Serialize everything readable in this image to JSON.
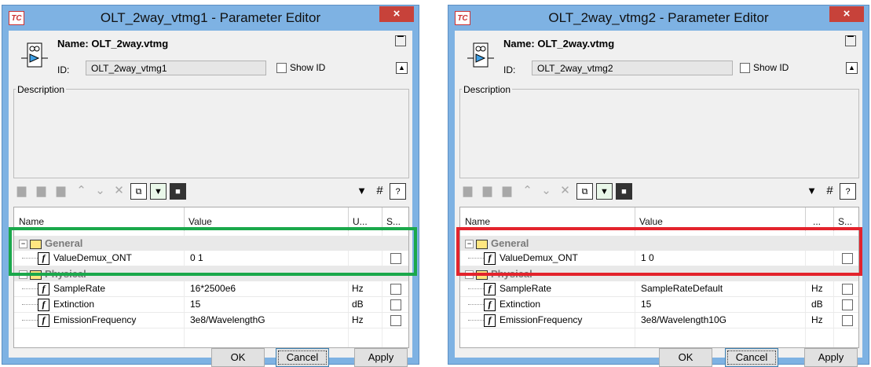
{
  "background_text": "►",
  "windows": [
    {
      "app_icon": "TC",
      "title": "OLT_2way_vtmg1 - Parameter Editor",
      "close": "×",
      "name_label": "Name:",
      "name_value": "OLT_2way.vtmg",
      "id_label": "ID:",
      "id_value": "OLT_2way_vtmg1",
      "show_id": "Show ID",
      "description_label": "Description",
      "columns": {
        "name": "Name",
        "value": "Value",
        "unit": "U...",
        "s": "S..."
      },
      "groups": [
        {
          "label": "General",
          "params": [
            {
              "name": "ValueDemux_ONT",
              "value": "0 1",
              "unit": ""
            }
          ]
        },
        {
          "label": "Physical",
          "params": [
            {
              "name": "SampleRate",
              "value": "16*2500e6",
              "unit": "Hz"
            },
            {
              "name": "Extinction",
              "value": "15",
              "unit": "dB"
            },
            {
              "name": "EmissionFrequency",
              "value": "3e8/WavelengthG",
              "unit": "Hz"
            }
          ]
        }
      ],
      "buttons": {
        "ok": "OK",
        "cancel": "Cancel",
        "apply": "Apply"
      },
      "highlight_color": "#1aa84b"
    },
    {
      "app_icon": "TC",
      "title": "OLT_2way_vtmg2 - Parameter Editor",
      "close": "×",
      "name_label": "Name:",
      "name_value": "OLT_2way.vtmg",
      "id_label": "ID:",
      "id_value": "OLT_2way_vtmg2",
      "show_id": "Show ID",
      "description_label": "Description",
      "columns": {
        "name": "Name",
        "value": "Value",
        "unit": "...",
        "s": "S..."
      },
      "groups": [
        {
          "label": "General",
          "params": [
            {
              "name": "ValueDemux_ONT",
              "value": "1 0",
              "unit": ""
            }
          ]
        },
        {
          "label": "Physical",
          "params": [
            {
              "name": "SampleRate",
              "value": "SampleRateDefault",
              "unit": "Hz"
            },
            {
              "name": "Extinction",
              "value": "15",
              "unit": "dB"
            },
            {
              "name": "EmissionFrequency",
              "value": "3e8/Wavelength10G",
              "unit": "Hz"
            }
          ]
        }
      ],
      "buttons": {
        "ok": "OK",
        "cancel": "Cancel",
        "apply": "Apply"
      },
      "highlight_color": "#e3232c"
    }
  ]
}
